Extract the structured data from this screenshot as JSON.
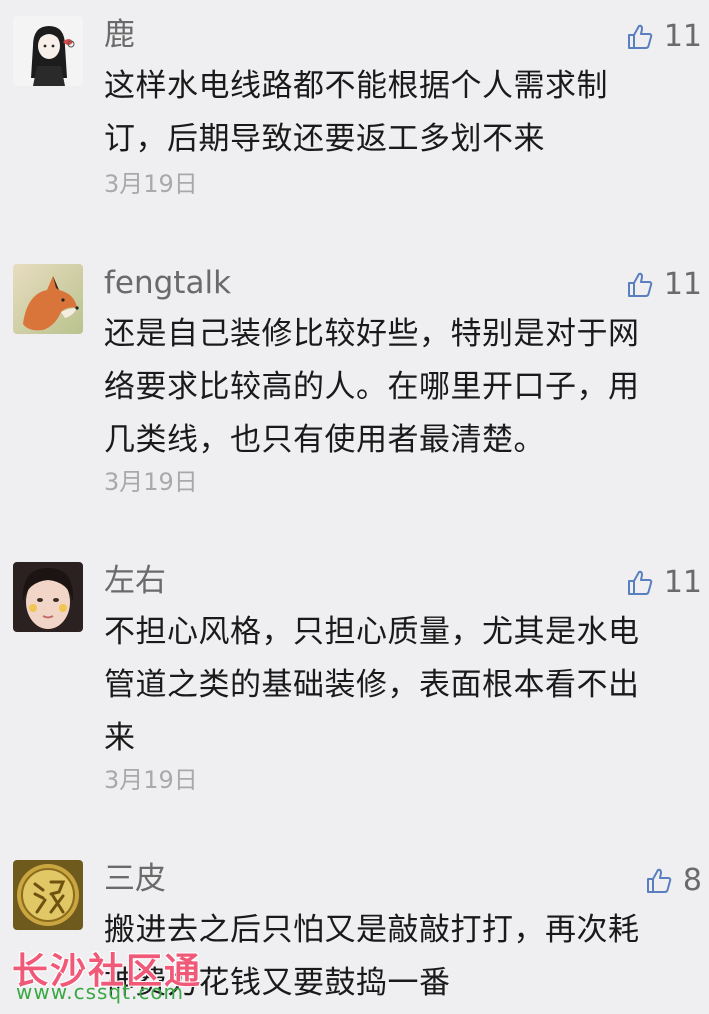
{
  "like_icon_color": "#5a7fbf",
  "comments": [
    {
      "username": "鹿",
      "likes": "11",
      "lines": [
        "这样水电线路都不能根据个人需求制",
        "订，后期导致还要返工多划不来"
      ],
      "date": "3月19日",
      "avatar": "girl-avatar"
    },
    {
      "username": "fengtalk",
      "likes": "11",
      "lines": [
        "还是自己装修比较好些，特别是对于网",
        "络要求比较高的人。在哪里开口子，用",
        "几类线，也只有使用者最清楚。"
      ],
      "date": "3月19日",
      "avatar": "fox-avatar"
    },
    {
      "username": "左右",
      "likes": "11",
      "lines": [
        "不担心风格，只担心质量，尤其是水电",
        "管道之类的基础装修，表面根本看不出",
        "来"
      ],
      "date": "3月19日",
      "avatar": "face-avatar"
    },
    {
      "username": "三皮",
      "likes": "8",
      "lines": [
        "搬进去之后只怕又是敲敲打打，再次耗",
        "神费力花钱又要鼓捣一番"
      ],
      "date": "",
      "avatar": "gold-coin-avatar"
    }
  ],
  "watermark": {
    "title": "长沙社区通",
    "url": "www.cssqt.com"
  }
}
